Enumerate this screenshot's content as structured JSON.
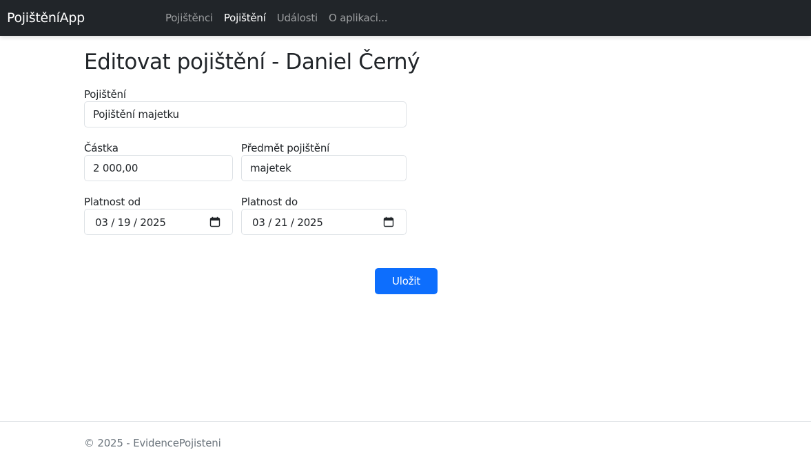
{
  "navbar": {
    "brand": "PojištěníApp",
    "links": [
      {
        "label": "Pojištěnci",
        "active": false
      },
      {
        "label": "Pojištění",
        "active": true
      },
      {
        "label": "Události",
        "active": false
      },
      {
        "label": "O aplikaci...",
        "active": false
      }
    ]
  },
  "main": {
    "title": "Editovat pojištění - Daniel Černý",
    "form": {
      "insurance": {
        "label": "Pojištění",
        "value": "Pojištění majetku"
      },
      "amount": {
        "label": "Částka",
        "value": "2 000,00"
      },
      "subject": {
        "label": "Předmět pojištění",
        "value": "majetek"
      },
      "valid_from": {
        "label": "Platnost od",
        "value": "03 / 19 / 2025",
        "icon": "calendar-icon"
      },
      "valid_to": {
        "label": "Platnost do",
        "value": "03 / 21 / 2025",
        "icon": "calendar-icon"
      },
      "submit_label": "Uložit"
    }
  },
  "footer": {
    "text": "© 2025 - EvidencePojisteni"
  },
  "colors": {
    "navbar_bg": "#212529",
    "primary": "#0d6efd",
    "muted": "#6c757d"
  }
}
